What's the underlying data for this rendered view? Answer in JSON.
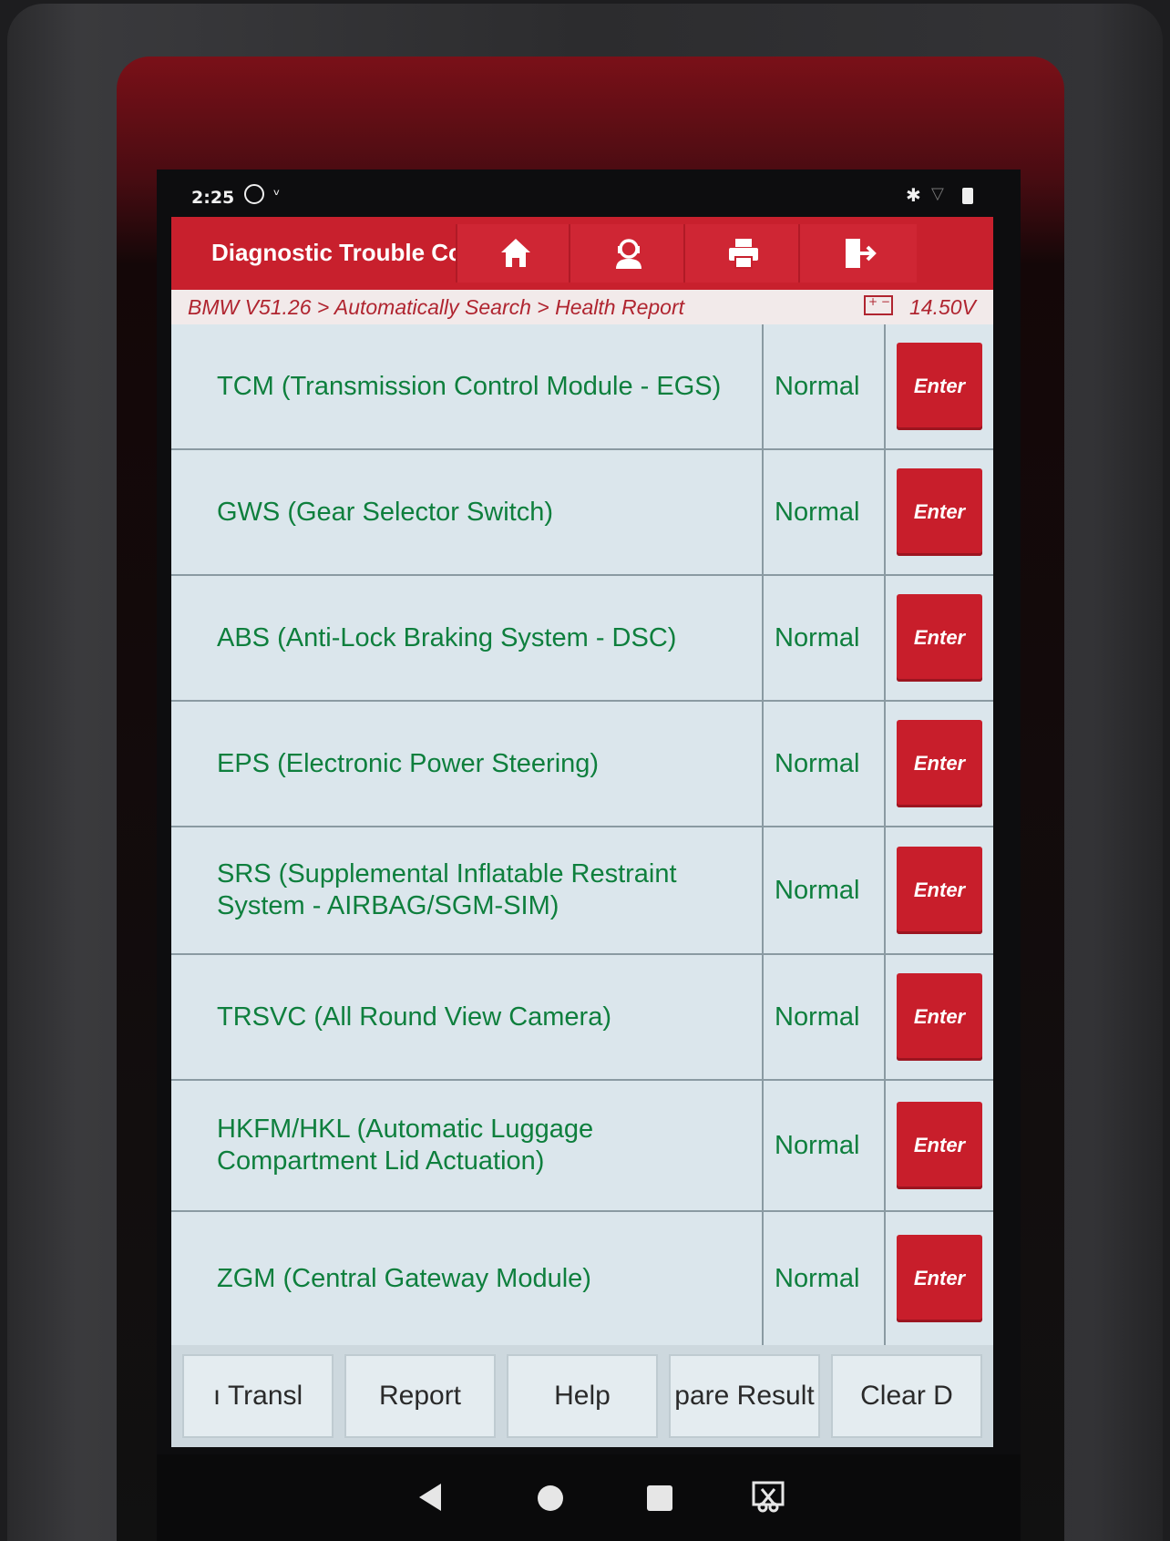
{
  "status_bar": {
    "time": "2:25"
  },
  "header": {
    "title": "Diagnostic Trouble Cc",
    "buttons": [
      {
        "icon": "home-icon"
      },
      {
        "icon": "support-agent-icon"
      },
      {
        "icon": "printer-icon"
      },
      {
        "icon": "exit-icon"
      }
    ]
  },
  "breadcrumb": {
    "path": "BMW V51.26 > Automatically Search > Health Report",
    "voltage": "14.50V"
  },
  "modules": [
    {
      "name": "TCM (Transmission Control Module - EGS)",
      "status": "Normal",
      "action": "Enter"
    },
    {
      "name": "GWS (Gear Selector Switch)",
      "status": "Normal",
      "action": "Enter"
    },
    {
      "name": "ABS (Anti-Lock Braking System - DSC)",
      "status": "Normal",
      "action": "Enter"
    },
    {
      "name": "EPS (Electronic Power Steering)",
      "status": "Normal",
      "action": "Enter"
    },
    {
      "name": "SRS (Supplemental Inflatable Restraint System - AIRBAG/SGM-SIM)",
      "status": "Normal",
      "action": "Enter"
    },
    {
      "name": "TRSVC (All Round View Camera)",
      "status": "Normal",
      "action": "Enter"
    },
    {
      "name": "HKFM/HKL (Automatic Luggage Compartment Lid Actuation)",
      "status": "Normal",
      "action": "Enter"
    },
    {
      "name": "ZGM (Central Gateway Module)",
      "status": "Normal",
      "action": "Enter"
    }
  ],
  "toolbar": {
    "translate": "ı    Transl",
    "report": "Report",
    "help": "Help",
    "compare": "pare Result",
    "clear": "Clear D"
  },
  "colors": {
    "accent": "#c8202d",
    "text_green": "#0e7f3d",
    "table_bg": "#dbe6ec"
  }
}
